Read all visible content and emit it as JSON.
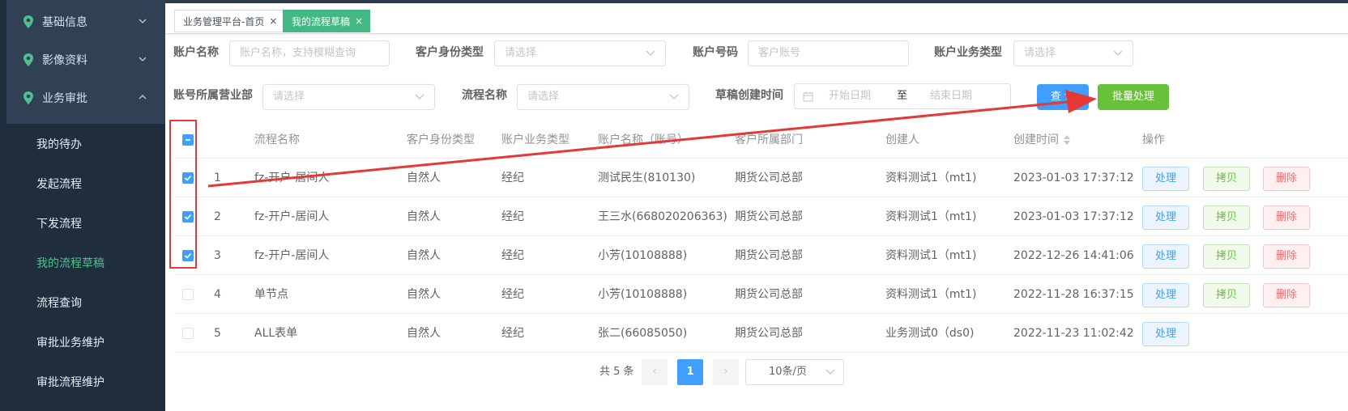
{
  "sidebar": {
    "menus": [
      {
        "label": "基础信息",
        "expanded": false
      },
      {
        "label": "影像资料",
        "expanded": false
      },
      {
        "label": "业务审批",
        "expanded": true
      }
    ],
    "items": [
      {
        "label": "我的待办",
        "active": false
      },
      {
        "label": "发起流程",
        "active": false
      },
      {
        "label": "下发流程",
        "active": false
      },
      {
        "label": "我的流程草稿",
        "active": true
      },
      {
        "label": "流程查询",
        "active": false
      },
      {
        "label": "审批业务维护",
        "active": false
      },
      {
        "label": "审批流程维护",
        "active": false
      }
    ]
  },
  "tags": [
    {
      "label": "业务管理平台-首页",
      "close": "×",
      "active": false
    },
    {
      "label": "我的流程草稿",
      "close": "×",
      "active": true
    }
  ],
  "form": {
    "account_name": {
      "label": "账户名称",
      "placeholder": "账户名称，支持模糊查询"
    },
    "cust_type": {
      "label": "客户身份类型",
      "placeholder": "请选择"
    },
    "account_no": {
      "label": "账户号码",
      "placeholder": "客户账号"
    },
    "biz_type": {
      "label": "账户业务类型",
      "placeholder": "请选择"
    },
    "dept": {
      "label": "账号所属营业部",
      "placeholder": "请选择"
    },
    "flow_name": {
      "label": "流程名称",
      "placeholder": "请选择"
    },
    "create_time": {
      "label": "草稿创建时间",
      "start": "开始日期",
      "sep": "至",
      "end": "结束日期"
    },
    "query_btn": "查 询",
    "batch_btn": "批量处理"
  },
  "table": {
    "headers": [
      "流程名称",
      "客户身份类型",
      "账户业务类型",
      "账户名称（账号）",
      "客户所属部门",
      "创建人",
      "创建时间",
      "操作"
    ],
    "rows": [
      {
        "no": "1",
        "flow": "fz-开户-居间人",
        "cust_type": "自然人",
        "biz_type": "经纪",
        "account": "测试民生(810130)",
        "dept": "期货公司总部",
        "creator": "资料测试1（mt1)",
        "time": "2023-01-03 17:37:12",
        "checked": true
      },
      {
        "no": "2",
        "flow": "fz-开户-居间人",
        "cust_type": "自然人",
        "biz_type": "经纪",
        "account": "王三水(668020206363)",
        "dept": "期货公司总部",
        "creator": "资料测试1（mt1)",
        "time": "2023-01-03 17:37:12",
        "checked": true
      },
      {
        "no": "3",
        "flow": "fz-开户-居间人",
        "cust_type": "自然人",
        "biz_type": "经纪",
        "account": "小芳(10108888)",
        "dept": "期货公司总部",
        "creator": "资料测试1（mt1)",
        "time": "2022-12-26 14:41:06",
        "checked": true
      },
      {
        "no": "4",
        "flow": "单节点",
        "cust_type": "自然人",
        "biz_type": "经纪",
        "account": "小芳(10108888)",
        "dept": "期货公司总部",
        "creator": "资料测试1（mt1)",
        "time": "2022-11-28 16:37:15",
        "checked": false
      },
      {
        "no": "5",
        "flow": "ALL表单",
        "cust_type": "自然人",
        "biz_type": "经纪",
        "account": "张二(66085050)",
        "dept": "期货公司总部",
        "creator": "业务测试0（ds0)",
        "time": "2022-11-23 11:02:42",
        "checked": false
      }
    ],
    "ops": {
      "handle": "处理",
      "copy": "拷贝",
      "delete": "删除"
    }
  },
  "pagination": {
    "total": "共 5 条",
    "prev": "‹",
    "page": "1",
    "next": "›",
    "size": "10条/页"
  },
  "colors": {
    "sidebar": "#304156",
    "submenu": "#1f2d3d",
    "accent": "#409eff",
    "active_menu": "#4fc08d",
    "success": "#67c23a",
    "danger": "#f56c6c",
    "annotation": "#e53935"
  },
  "icons": {
    "menu": "location-pin-icon",
    "chevron": "chevron-icon",
    "calendar": "calendar-icon",
    "sort": "sort-icon"
  }
}
